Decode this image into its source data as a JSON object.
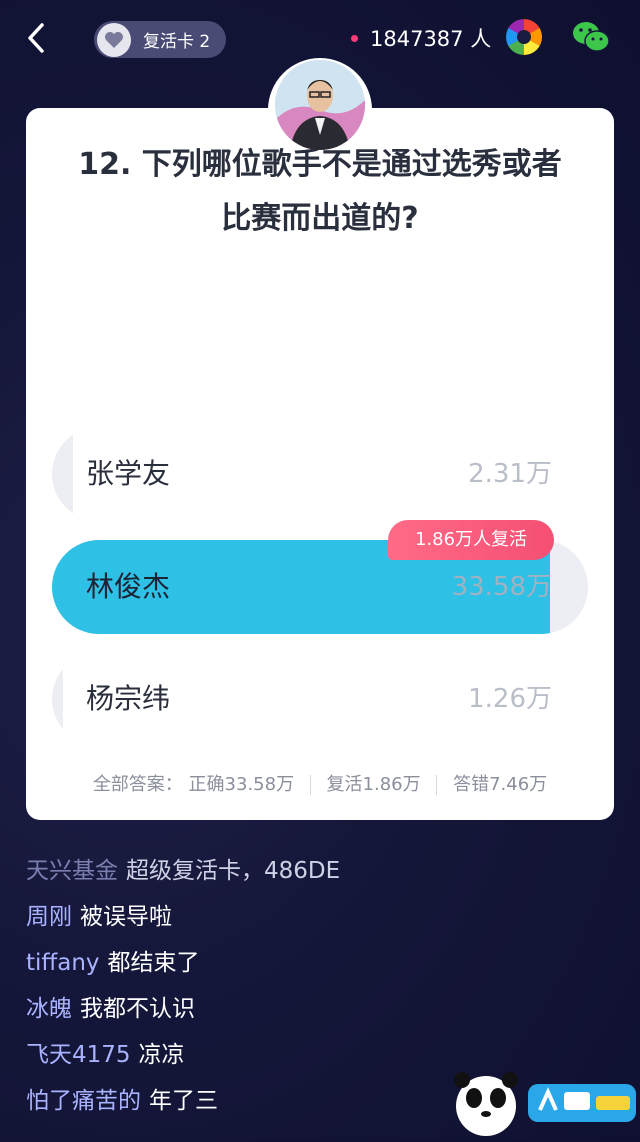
{
  "header": {
    "revive_card_label": "复活卡 2",
    "viewer_count": "1847387 人",
    "icons": [
      "back-icon",
      "heart-icon",
      "share-icon",
      "wechat-icon"
    ]
  },
  "question": {
    "text_line1": "12. 下列哪位歌手不是通过选秀或者",
    "text_line2": "比赛而出道的?"
  },
  "options": [
    {
      "name": "张学友",
      "count": "2.31万",
      "share": 0.063
    },
    {
      "name": "林俊杰",
      "count": "33.58万",
      "share": 1.0,
      "selected": true
    },
    {
      "name": "杨宗纬",
      "count": "1.26万",
      "share": 0.034
    }
  ],
  "revive_badge": "1.86万人复活",
  "stats": {
    "label": "全部答案：",
    "correct": "正确33.58万",
    "revived": "复活1.86万",
    "wrong": "答错7.46万"
  },
  "comments": [
    {
      "user": "天兴基金",
      "msg": "超级复活卡，486DE"
    },
    {
      "user": "周刚",
      "msg": "被误导啦"
    },
    {
      "user": "tiffany",
      "msg": "都结束了"
    },
    {
      "user": "冰魄",
      "msg": "我都不认识"
    },
    {
      "user": "飞天4175",
      "msg": "凉凉"
    },
    {
      "user": "怕了痛苦的",
      "msg": "年了三"
    }
  ],
  "colors": {
    "accent_blue": "#2fc0e6",
    "badge_pink": "#f54f74",
    "username": "#a9b3ff"
  }
}
